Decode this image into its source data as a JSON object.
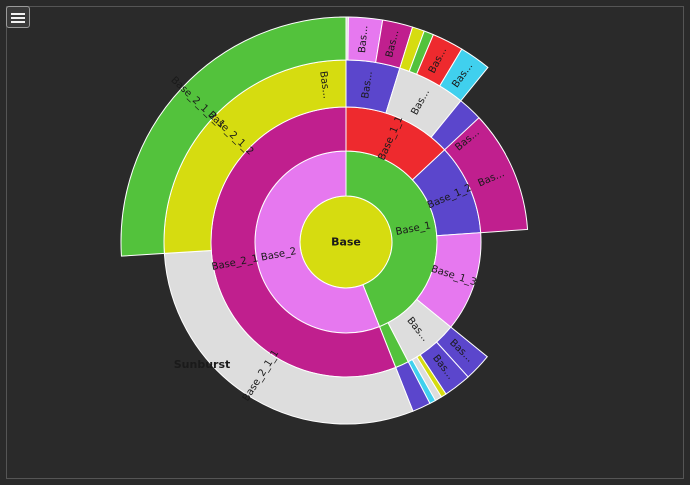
{
  "toolbar": {
    "menu_icon": "hamburger-menu-icon"
  },
  "chart_data": {
    "type": "sunburst",
    "title": "Sunburst",
    "root": {
      "name": "Base",
      "color": "#d6dc10",
      "children": [
        {
          "name": "Base_1",
          "color": "#53c23c",
          "value": 44,
          "children": [
            {
              "name": "Base_1_1",
              "color": "#ee2a2e",
              "value": 12,
              "ext": 1.6,
              "children": [
                {
                  "name": "Bas...",
                  "color": "#40d0ee",
                  "value": 2.0
                },
                {
                  "name": "Bas...",
                  "color": "#5b46cc",
                  "value": 3.0,
                  "children": [
                    {
                      "name": "",
                      "color": "#dddddd",
                      "value": 0.35
                    },
                    {
                      "name": "Bas...",
                      "color": "#e678ef",
                      "value": 1.4
                    },
                    {
                      "name": "Bas...",
                      "color": "#c01f8e",
                      "value": 1.25
                    }
                  ]
                },
                {
                  "name": "Bas...",
                  "color": "#dddddd",
                  "value": 3.5,
                  "children": [
                    {
                      "name": "",
                      "color": "#d6dc10",
                      "value": 0.5
                    },
                    {
                      "name": "",
                      "color": "#53c23c",
                      "value": 0.4
                    },
                    {
                      "name": "Bas...",
                      "color": "#ee2a2e",
                      "value": 1.3
                    },
                    {
                      "name": "Bas...",
                      "color": "#40d0ee",
                      "value": 1.3
                    }
                  ]
                },
                {
                  "name": "Bas...",
                  "color": "#5b46cc",
                  "value": 3.5
                }
              ]
            },
            {
              "name": "Base_1_2",
              "color": "#5b46cc",
              "value": 10,
              "children": [
                {
                  "name": "Bas...",
                  "color": "#c01f8e",
                  "value": 4.0
                }
              ]
            },
            {
              "name": "Base_1_3",
              "color": "#e678ef",
              "value": 11
            },
            {
              "name": "Bas...",
              "color": "#dddddd",
              "value": 6,
              "children": [
                {
                  "name": "Bas...",
                  "color": "#5b46cc",
                  "value": 1.8
                },
                {
                  "name": "Bas...",
                  "color": "#5b46cc",
                  "value": 1.8
                },
                {
                  "name": "",
                  "color": "#d6dc10",
                  "value": 0.35
                },
                {
                  "name": "",
                  "color": "#dddddd",
                  "value": 0.45
                },
                {
                  "name": "",
                  "color": "#40d0ee",
                  "value": 0.4
                }
              ]
            },
            {
              "name": "",
              "color": "#53c23c",
              "value": 1.5,
              "children": [
                {
                  "name": "",
                  "color": "#5b46cc",
                  "value": 1.5
                }
              ]
            }
          ]
        },
        {
          "name": "Base_2",
          "color": "#e678ef",
          "value": 56,
          "children": [
            {
              "name": "Base_2_1",
              "color": "#c01f8e",
              "value": 56,
              "children": [
                {
                  "name": "Base_2_1_1",
                  "color": "#dddddd",
                  "value": 30
                },
                {
                  "name": "Base_2_1_2",
                  "color": "#d6dc10",
                  "value": 26,
                  "children": [
                    {
                      "name": "Base_2_1_2_1",
                      "color": "#53c23c",
                      "value": 26
                    }
                  ]
                }
              ]
            }
          ]
        }
      ]
    }
  }
}
